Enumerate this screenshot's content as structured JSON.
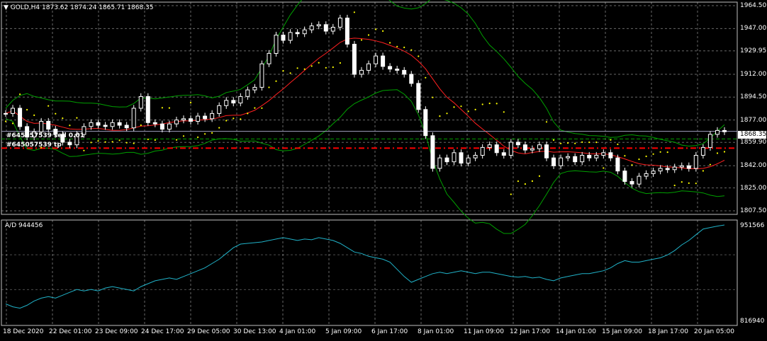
{
  "header": {
    "menu_glyph": "▼",
    "symbol_label": "GOLD,H4",
    "ohlc": "1873.62 1874.24 1865.71 1868.35"
  },
  "order_labels": {
    "line1": "#645057539 sell 0.01",
    "line2": "#645057539 tp"
  },
  "price_axis": {
    "ticks": [
      "1964.50",
      "1947.00",
      "1929.95",
      "1912.00",
      "1894.50",
      "1877.00",
      "1859.90",
      "1842.00",
      "1825.00",
      "1807.50"
    ],
    "current": "1868.35"
  },
  "indicator": {
    "label": "A/D 944456",
    "max": "951566",
    "min": "816940"
  },
  "time_axis": {
    "labels": [
      "18 Dec 2020",
      "22 Dec 01:00",
      "23 Dec 09:00",
      "24 Dec 17:00",
      "29 Dec 05:00",
      "30 Dec 13:00",
      "4 Jan 01:00",
      "5 Jan 09:00",
      "6 Jan 17:00",
      "8 Jan 01:00",
      "11 Jan 09:00",
      "12 Jan 17:00",
      "14 Jan 01:00",
      "15 Jan 09:00",
      "18 Jan 17:00",
      "20 Jan 05:00"
    ]
  },
  "colors": {
    "background": "#000000",
    "grid": "#c0c0c0",
    "candle": "#ffffff",
    "bollinger": "#00a000",
    "moving_average": "#ff2020",
    "parabolic_sar": "#ffff00",
    "order_line": "#ff0000",
    "ad_line": "#20b2c8"
  },
  "chart_data": {
    "type": "candlestick",
    "symbol": "GOLD",
    "timeframe": "H4",
    "ylim": [
      1807.5,
      1964.5
    ],
    "close": [
      1882,
      1886,
      1872,
      1864,
      1868,
      1876,
      1870,
      1866,
      1860,
      1858,
      1866,
      1872,
      1875,
      1873,
      1872,
      1875,
      1873,
      1871,
      1886,
      1895,
      1875,
      1874,
      1870,
      1874,
      1877,
      1878,
      1876,
      1880,
      1878,
      1882,
      1888,
      1892,
      1890,
      1895,
      1900,
      1902,
      1920,
      1928,
      1942,
      1938,
      1944,
      1943,
      1946,
      1949,
      1950,
      1945,
      1948,
      1955,
      1935,
      1912,
      1915,
      1920,
      1926,
      1918,
      1916,
      1915,
      1912,
      1905,
      1885,
      1865,
      1840,
      1848,
      1845,
      1852,
      1844,
      1848,
      1850,
      1856,
      1858,
      1852,
      1850,
      1860,
      1858,
      1854,
      1855,
      1858,
      1848,
      1842,
      1848,
      1849,
      1845,
      1850,
      1848,
      1850,
      1852,
      1848,
      1838,
      1830,
      1828,
      1834,
      1836,
      1838,
      1840,
      1839,
      1841,
      1842,
      1840,
      1850,
      1856,
      1866,
      1869,
      1868
    ],
    "ad_ylim": [
      816940,
      951566
    ],
    "ad_values": [
      842000,
      838000,
      836000,
      840000,
      846000,
      850000,
      852000,
      850000,
      854000,
      858000,
      862000,
      860000,
      862000,
      860000,
      864000,
      866000,
      864000,
      862000,
      860000,
      866000,
      870000,
      874000,
      876000,
      878000,
      876000,
      880000,
      884000,
      888000,
      892000,
      898000,
      904000,
      912000,
      920000,
      925000,
      926000,
      927000,
      928000,
      930000,
      932000,
      934000,
      932000,
      930000,
      932000,
      931000,
      934000,
      932000,
      930000,
      926000,
      920000,
      914000,
      912000,
      908000,
      906000,
      904000,
      900000,
      890000,
      880000,
      872000,
      876000,
      880000,
      884000,
      886000,
      884000,
      886000,
      888000,
      886000,
      884000,
      886000,
      886000,
      884000,
      882000,
      880000,
      879000,
      880000,
      878000,
      879000,
      876000,
      874000,
      878000,
      880000,
      882000,
      884000,
      884000,
      886000,
      888000,
      892000,
      898000,
      902000,
      900000,
      900000,
      902000,
      904000,
      906000,
      910000,
      916000,
      924000,
      930000,
      938000,
      946000,
      948000,
      950000,
      951566
    ]
  }
}
